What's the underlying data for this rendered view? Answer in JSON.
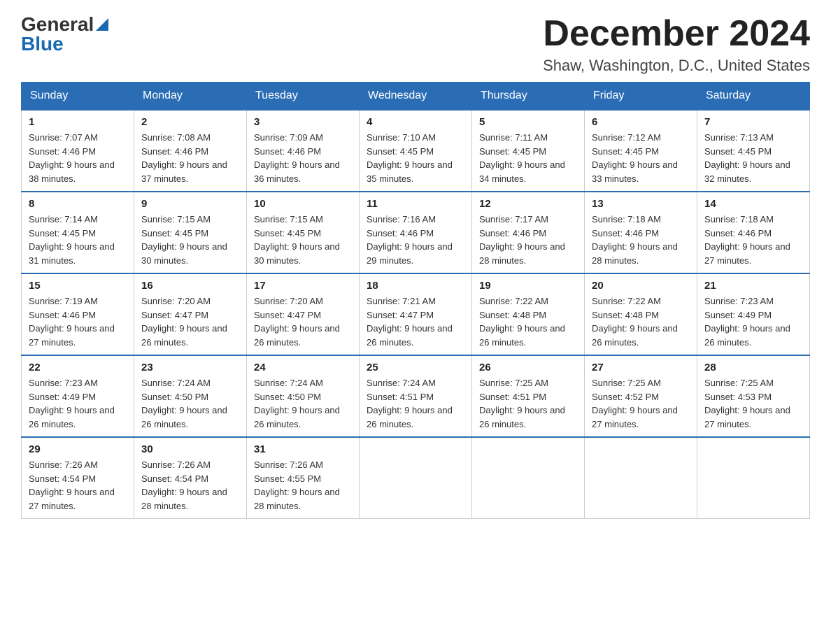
{
  "logo": {
    "general": "General",
    "triangle": "▶",
    "blue": "Blue"
  },
  "header": {
    "month_year": "December 2024",
    "location": "Shaw, Washington, D.C., United States"
  },
  "weekdays": [
    "Sunday",
    "Monday",
    "Tuesday",
    "Wednesday",
    "Thursday",
    "Friday",
    "Saturday"
  ],
  "weeks": [
    [
      {
        "day": "1",
        "sunrise": "7:07 AM",
        "sunset": "4:46 PM",
        "daylight": "9 hours and 38 minutes."
      },
      {
        "day": "2",
        "sunrise": "7:08 AM",
        "sunset": "4:46 PM",
        "daylight": "9 hours and 37 minutes."
      },
      {
        "day": "3",
        "sunrise": "7:09 AM",
        "sunset": "4:46 PM",
        "daylight": "9 hours and 36 minutes."
      },
      {
        "day": "4",
        "sunrise": "7:10 AM",
        "sunset": "4:45 PM",
        "daylight": "9 hours and 35 minutes."
      },
      {
        "day": "5",
        "sunrise": "7:11 AM",
        "sunset": "4:45 PM",
        "daylight": "9 hours and 34 minutes."
      },
      {
        "day": "6",
        "sunrise": "7:12 AM",
        "sunset": "4:45 PM",
        "daylight": "9 hours and 33 minutes."
      },
      {
        "day": "7",
        "sunrise": "7:13 AM",
        "sunset": "4:45 PM",
        "daylight": "9 hours and 32 minutes."
      }
    ],
    [
      {
        "day": "8",
        "sunrise": "7:14 AM",
        "sunset": "4:45 PM",
        "daylight": "9 hours and 31 minutes."
      },
      {
        "day": "9",
        "sunrise": "7:15 AM",
        "sunset": "4:45 PM",
        "daylight": "9 hours and 30 minutes."
      },
      {
        "day": "10",
        "sunrise": "7:15 AM",
        "sunset": "4:45 PM",
        "daylight": "9 hours and 30 minutes."
      },
      {
        "day": "11",
        "sunrise": "7:16 AM",
        "sunset": "4:46 PM",
        "daylight": "9 hours and 29 minutes."
      },
      {
        "day": "12",
        "sunrise": "7:17 AM",
        "sunset": "4:46 PM",
        "daylight": "9 hours and 28 minutes."
      },
      {
        "day": "13",
        "sunrise": "7:18 AM",
        "sunset": "4:46 PM",
        "daylight": "9 hours and 28 minutes."
      },
      {
        "day": "14",
        "sunrise": "7:18 AM",
        "sunset": "4:46 PM",
        "daylight": "9 hours and 27 minutes."
      }
    ],
    [
      {
        "day": "15",
        "sunrise": "7:19 AM",
        "sunset": "4:46 PM",
        "daylight": "9 hours and 27 minutes."
      },
      {
        "day": "16",
        "sunrise": "7:20 AM",
        "sunset": "4:47 PM",
        "daylight": "9 hours and 26 minutes."
      },
      {
        "day": "17",
        "sunrise": "7:20 AM",
        "sunset": "4:47 PM",
        "daylight": "9 hours and 26 minutes."
      },
      {
        "day": "18",
        "sunrise": "7:21 AM",
        "sunset": "4:47 PM",
        "daylight": "9 hours and 26 minutes."
      },
      {
        "day": "19",
        "sunrise": "7:22 AM",
        "sunset": "4:48 PM",
        "daylight": "9 hours and 26 minutes."
      },
      {
        "day": "20",
        "sunrise": "7:22 AM",
        "sunset": "4:48 PM",
        "daylight": "9 hours and 26 minutes."
      },
      {
        "day": "21",
        "sunrise": "7:23 AM",
        "sunset": "4:49 PM",
        "daylight": "9 hours and 26 minutes."
      }
    ],
    [
      {
        "day": "22",
        "sunrise": "7:23 AM",
        "sunset": "4:49 PM",
        "daylight": "9 hours and 26 minutes."
      },
      {
        "day": "23",
        "sunrise": "7:24 AM",
        "sunset": "4:50 PM",
        "daylight": "9 hours and 26 minutes."
      },
      {
        "day": "24",
        "sunrise": "7:24 AM",
        "sunset": "4:50 PM",
        "daylight": "9 hours and 26 minutes."
      },
      {
        "day": "25",
        "sunrise": "7:24 AM",
        "sunset": "4:51 PM",
        "daylight": "9 hours and 26 minutes."
      },
      {
        "day": "26",
        "sunrise": "7:25 AM",
        "sunset": "4:51 PM",
        "daylight": "9 hours and 26 minutes."
      },
      {
        "day": "27",
        "sunrise": "7:25 AM",
        "sunset": "4:52 PM",
        "daylight": "9 hours and 27 minutes."
      },
      {
        "day": "28",
        "sunrise": "7:25 AM",
        "sunset": "4:53 PM",
        "daylight": "9 hours and 27 minutes."
      }
    ],
    [
      {
        "day": "29",
        "sunrise": "7:26 AM",
        "sunset": "4:54 PM",
        "daylight": "9 hours and 27 minutes."
      },
      {
        "day": "30",
        "sunrise": "7:26 AM",
        "sunset": "4:54 PM",
        "daylight": "9 hours and 28 minutes."
      },
      {
        "day": "31",
        "sunrise": "7:26 AM",
        "sunset": "4:55 PM",
        "daylight": "9 hours and 28 minutes."
      },
      null,
      null,
      null,
      null
    ]
  ]
}
